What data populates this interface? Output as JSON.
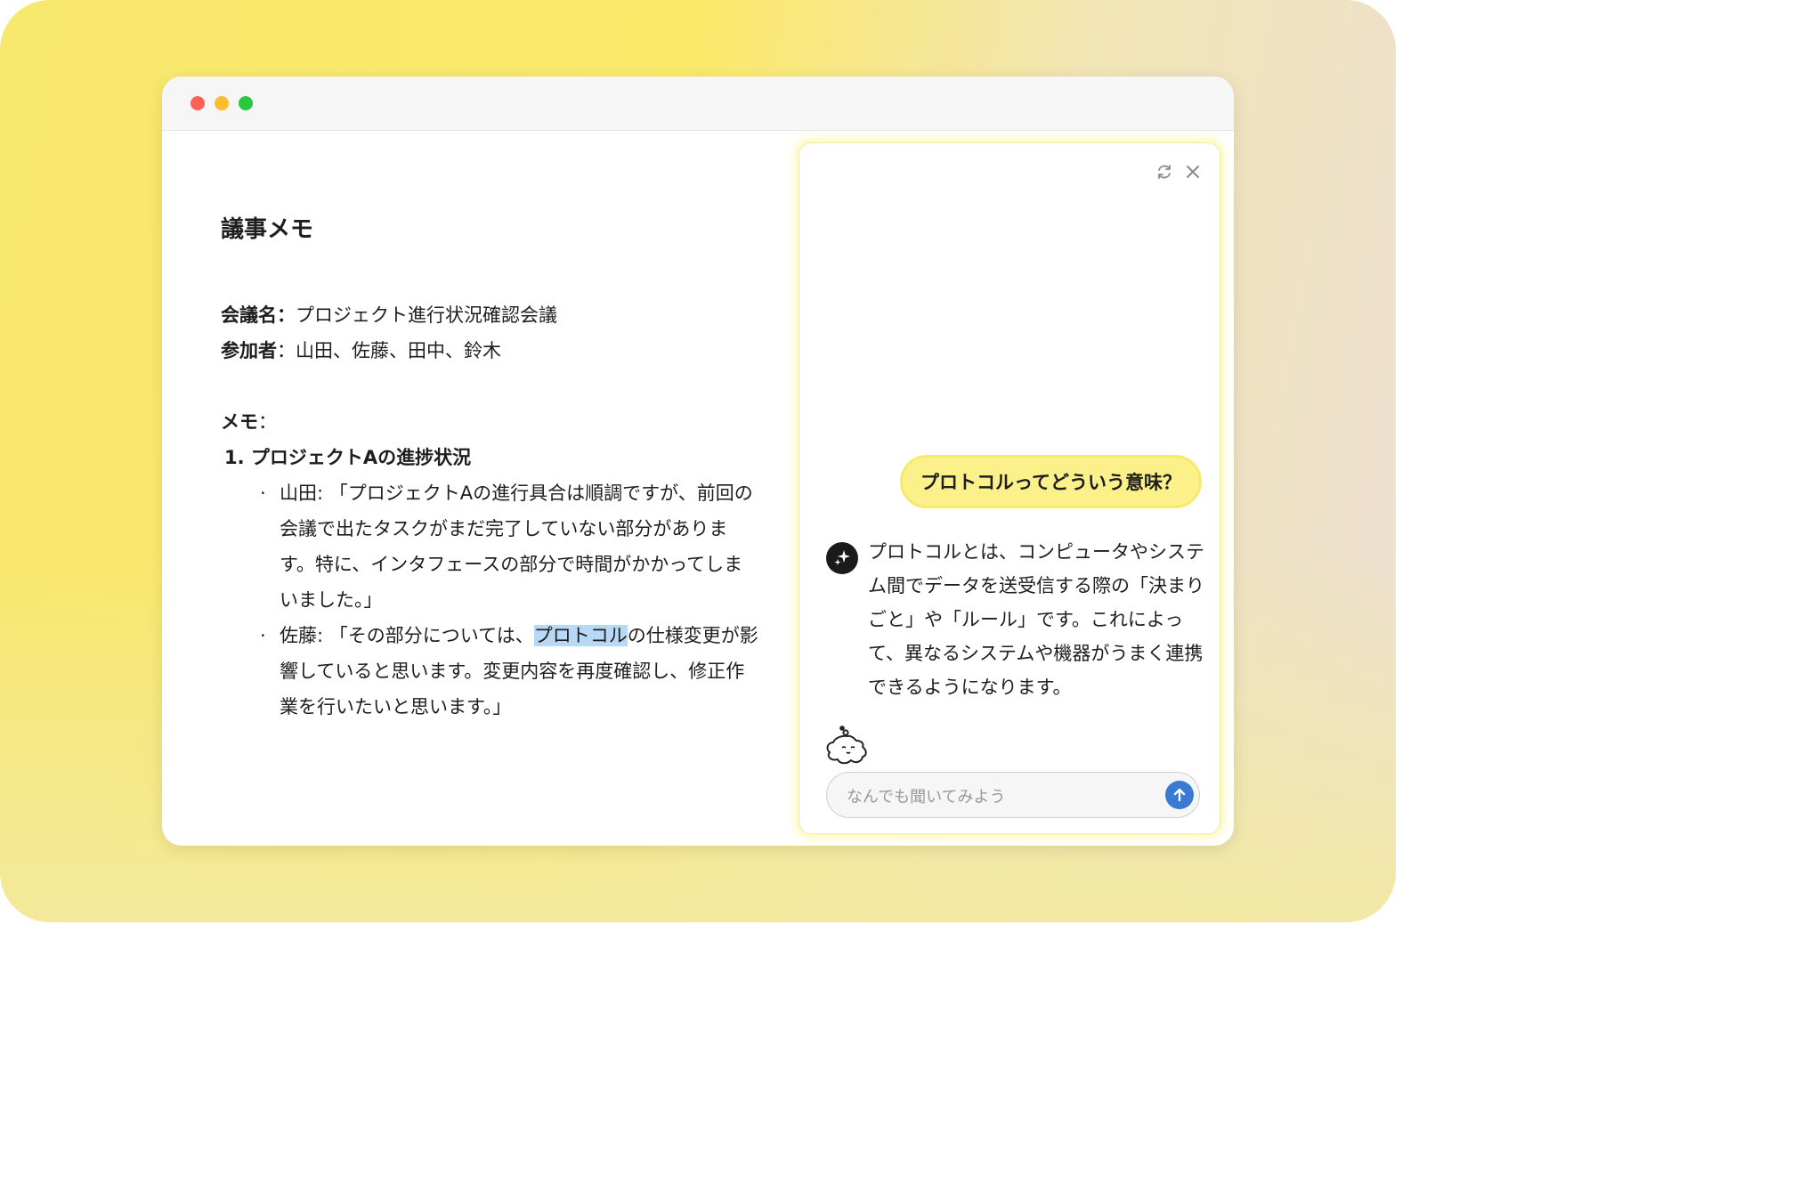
{
  "document": {
    "title": "議事メモ",
    "meeting_label": "会議名：",
    "meeting_value": "プロジェクト進行状況確認会議",
    "participants_label": "参加者",
    "participants_value": "：山田、佐藤、田中、鈴木",
    "memo_label": "メモ",
    "memo_colon": "：",
    "section_1": "1. プロジェクトAの進捗状況",
    "bullet_1": "山田: 「プロジェクトAの進行具合は順調ですが、前回の会議で出たタスクがまだ完了していない部分があります。特に、インタフェースの部分で時間がかかってしまいました。」",
    "bullet_2_pre": "佐藤: 「その部分については、",
    "bullet_2_highlight": "プロトコル",
    "bullet_2_post": "の仕様変更が影響していると思います。変更内容を再度確認し、修正作業を行いたいと思います。」",
    "bullet_marker": "·"
  },
  "assistant": {
    "user_message": "プロトコルってどういう意味？",
    "ai_message": "プロトコルとは、コンピュータやシステム間でデータを送受信する際の「決まりごと」や「ルール」です。これによって、異なるシステムや機器がうまく連携できるようになります。",
    "input_placeholder": "なんでも聞いてみよう",
    "icons": [
      "refresh-icon",
      "close-icon",
      "sparkle-icon",
      "mascot-icon",
      "send-arrow-icon"
    ]
  },
  "colors": {
    "highlight": "#b8d8f8",
    "user_bubble": "#fbf08a",
    "send_button": "#3a79d4"
  }
}
